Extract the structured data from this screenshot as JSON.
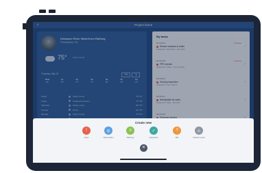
{
  "header": {
    "title": "Project home"
  },
  "project": {
    "name": "Delaware River Waterfront Railway",
    "location": "Philadelphia, PA"
  },
  "weather": {
    "temp": "75°",
    "desc": "Partly cloudy"
  },
  "forecast": {
    "label": "Thursday, May 16",
    "toggles": [
      "24h",
      "7d"
    ],
    "hours": [
      {
        "h": "Now",
        "t": "75°"
      },
      {
        "h": "1p",
        "t": "76°"
      },
      {
        "h": "2p",
        "t": "77°"
      },
      {
        "h": "3p",
        "t": "77°"
      },
      {
        "h": "4p",
        "t": "76°"
      },
      {
        "h": "5p",
        "t": "75°"
      },
      {
        "h": "6p",
        "t": "73°"
      }
    ],
    "days": [
      {
        "d": "Today",
        "c": "Partly cloudy",
        "t": "78° 61°"
      },
      {
        "d": "Friday",
        "c": "Scattered showers",
        "t": "74° 60°"
      },
      {
        "d": "Saturday",
        "c": "Mostly sunny",
        "t": "80° 63°"
      },
      {
        "d": "Sunday",
        "c": "Sunny",
        "t": "82° 65°"
      },
      {
        "d": "Monday",
        "c": "Partly cloudy",
        "t": "79° 64°"
      },
      {
        "d": "Tuesday",
        "c": "Rain",
        "t": "71° 59°"
      },
      {
        "d": "Wednesday",
        "c": "Cloudy",
        "t": "73° 60°"
      }
    ]
  },
  "tasks": {
    "title": "My tasks",
    "items": [
      {
        "id": "RFI #1042",
        "title": "Shower windows in trailer",
        "sub": "Assigned to: Field Team · Due today",
        "badge": "Overdue"
      },
      {
        "id": "RFI #1038",
        "title": "PPE needed",
        "sub": "Assigned to: Safety · Due tomorrow",
        "badge": "Overdue"
      },
      {
        "id": "RFI #1031",
        "title": "Grading inspection",
        "sub": "Assigned to: Civil · Due Fri",
        "badge": ""
      },
      {
        "id": "RFI #1027",
        "title": "Nameplates for sales",
        "sub": "Assigned to: Sales · Due Mon",
        "badge": ""
      },
      {
        "id": "RFI #1019",
        "title": "Electrical warning",
        "sub": "Assigned to: Electrical · Due Tue",
        "badge": ""
      }
    ]
  },
  "create_sheet": {
    "title": "Create new",
    "items": [
      {
        "label": "Issue",
        "color": "#e8604c",
        "icon": "issue-icon",
        "glyph": "!"
      },
      {
        "label": "Observation",
        "color": "#5aa0e0",
        "icon": "observation-icon",
        "glyph": "◎"
      },
      {
        "label": "Daily log",
        "color": "#8cc152",
        "icon": "daily-log-icon",
        "glyph": "≡"
      },
      {
        "label": "Inspection",
        "color": "#3ea8a0",
        "icon": "inspection-icon",
        "glyph": "✓"
      },
      {
        "label": "RFI",
        "color": "#f0953a",
        "icon": "rfi-icon",
        "glyph": "?"
      },
      {
        "label": "Incident report",
        "color": "#8f96a3",
        "icon": "incident-icon",
        "glyph": "⚠"
      }
    ]
  }
}
